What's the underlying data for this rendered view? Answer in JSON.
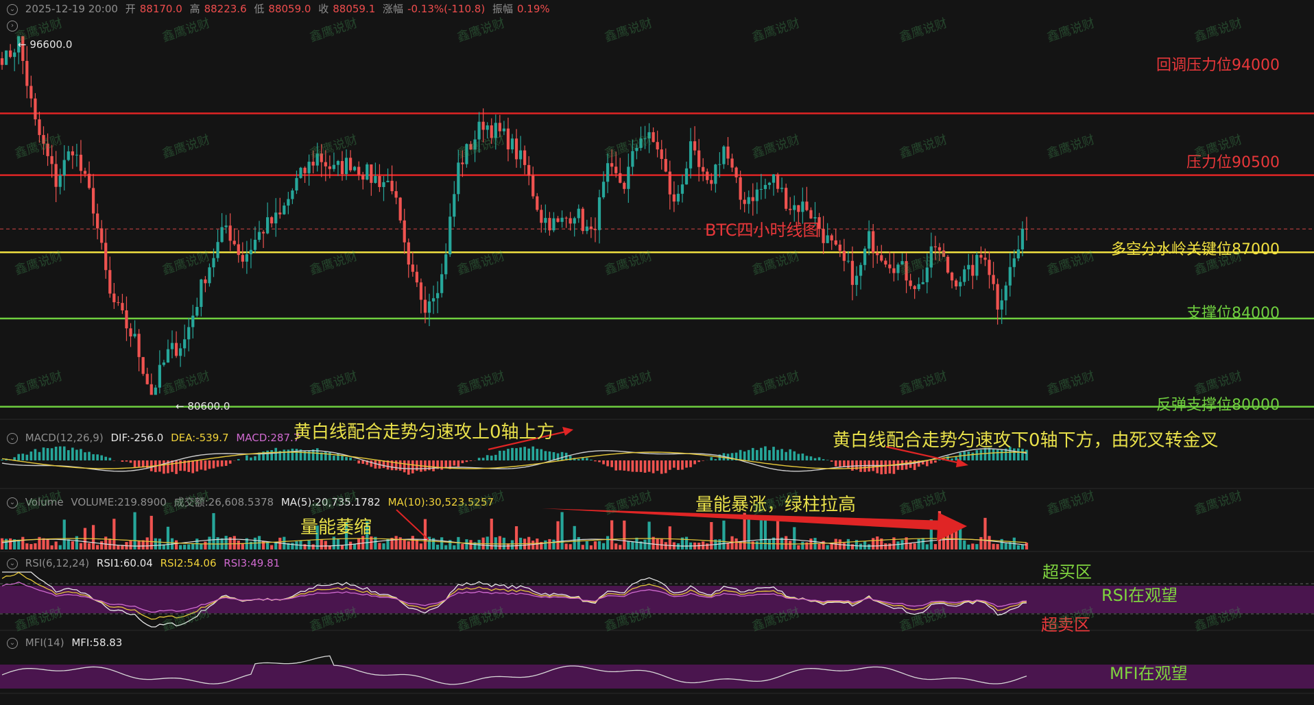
{
  "top_bar": {
    "datetime": "2025-12-19 20:00",
    "open_label": "开",
    "open": "88170.0",
    "high_label": "高",
    "high": "88223.6",
    "low_label": "低",
    "low": "88059.0",
    "close_label": "收",
    "close": "88059.1",
    "change_label": "涨幅",
    "change": "-0.13%(-110.8)",
    "amplitude_label": "振幅",
    "amplitude": "0.19%"
  },
  "price_panel": {
    "title": "BTC四小时线图",
    "max_marker": "← 96600.0",
    "min_marker": "← 80600.0",
    "levels": [
      {
        "label": "回调压力位94000",
        "price": 94000,
        "color": "#e02525",
        "line": false
      },
      {
        "label": "压力位90500",
        "price": 90500,
        "color": "#e02525",
        "line": true
      },
      {
        "label": "",
        "price": 93300,
        "color": "#e02525",
        "line": true
      },
      {
        "label": "多空分水岭关键位87000",
        "price": 87000,
        "color": "#f0e040",
        "line": true
      },
      {
        "label": "支撑位84000",
        "price": 84000,
        "color": "#6fcf3f",
        "line": true
      },
      {
        "label": "反弹支撑位80000",
        "price": 80000,
        "color": "#6fcf3f",
        "line": true
      }
    ],
    "dashed_ref": 88059,
    "colors": {
      "up": "#26a69a",
      "down": "#ef5350"
    }
  },
  "macd_panel": {
    "name": "MACD(12,26,9)",
    "dif": "DIF:-256.0",
    "dea": "DEA:-539.7",
    "macd": "MACD:287.7",
    "note_left": "黄白线配合走势匀速攻上0轴上方",
    "note_right": "黄白线配合走势匀速攻下0轴下方，由死叉转金叉"
  },
  "volume_panel": {
    "name": "Volume",
    "volume": "VOLUME:219.8900",
    "turnover": "成交额:26,608.5378",
    "ma5": "MA(5):20,735.1782",
    "ma10": "MA(10):30,523.5257",
    "note_shrink": "量能萎缩",
    "note_surge": "量能暴涨，绿柱拉高"
  },
  "rsi_panel": {
    "name": "RSI(6,12,24)",
    "rsi1": "RSI1:60.04",
    "rsi2": "RSI2:54.06",
    "rsi3": "RSI3:49.81",
    "overbought": "超买区",
    "watch": "RSI在观望",
    "oversold": "超卖区"
  },
  "mfi_panel": {
    "name": "MFI(14)",
    "value": "MFI:58.83",
    "watch": "MFI在观望"
  },
  "watermark": "鑫鹰说财",
  "chart_data": {
    "type": "candlestick",
    "title": "BTC四小时线图",
    "timeframe": "4H",
    "last_bar": {
      "time": "2025-12-19 20:00",
      "open": 88170.0,
      "high": 88223.6,
      "low": 88059.0,
      "close": 88059.1
    },
    "range": {
      "high": 96600.0,
      "low": 80600.0
    },
    "ylim": [
      79800,
      97200
    ],
    "path": [
      [
        0,
        95500
      ],
      [
        4,
        96600
      ],
      [
        8,
        92800
      ],
      [
        13,
        90200
      ],
      [
        17,
        91800
      ],
      [
        22,
        89100
      ],
      [
        26,
        85000
      ],
      [
        32,
        83000
      ],
      [
        36,
        80600
      ],
      [
        40,
        82400
      ],
      [
        44,
        83000
      ],
      [
        49,
        86000
      ],
      [
        54,
        88200
      ],
      [
        58,
        86700
      ],
      [
        63,
        88100
      ],
      [
        67,
        88600
      ],
      [
        71,
        90200
      ],
      [
        76,
        91400
      ],
      [
        80,
        90700
      ],
      [
        84,
        91100
      ],
      [
        89,
        90400
      ],
      [
        94,
        90100
      ],
      [
        98,
        86100
      ],
      [
        102,
        84700
      ],
      [
        106,
        85900
      ],
      [
        110,
        90900
      ],
      [
        116,
        92900
      ],
      [
        122,
        92100
      ],
      [
        126,
        90900
      ],
      [
        130,
        88600
      ],
      [
        134,
        88200
      ],
      [
        138,
        88900
      ],
      [
        142,
        87700
      ],
      [
        146,
        90600
      ],
      [
        150,
        90100
      ],
      [
        154,
        92400
      ],
      [
        158,
        91800
      ],
      [
        162,
        89100
      ],
      [
        166,
        91600
      ],
      [
        170,
        89900
      ],
      [
        174,
        91800
      ],
      [
        178,
        89400
      ],
      [
        182,
        89700
      ],
      [
        186,
        90300
      ],
      [
        190,
        89100
      ],
      [
        194,
        89100
      ],
      [
        198,
        87800
      ],
      [
        202,
        86700
      ],
      [
        206,
        85700
      ],
      [
        209,
        87600
      ],
      [
        213,
        86800
      ],
      [
        217,
        86200
      ],
      [
        221,
        85400
      ],
      [
        225,
        87300
      ],
      [
        229,
        85800
      ],
      [
        233,
        86000
      ],
      [
        237,
        87000
      ],
      [
        240,
        84700
      ],
      [
        243,
        86200
      ],
      [
        247,
        88100
      ]
    ],
    "levels": [
      94000,
      90500,
      87000,
      84000,
      80000
    ],
    "indicators": {
      "MACD": {
        "DIF": -256.0,
        "DEA": -539.7,
        "MACD": 287.7
      },
      "VOLUME": 219.89,
      "MA5": 20735.1782,
      "MA10": 30523.5257,
      "RSI": {
        "RSI1": 60.04,
        "RSI2": 54.06,
        "RSI3": 49.81
      },
      "MFI": 58.83
    }
  }
}
